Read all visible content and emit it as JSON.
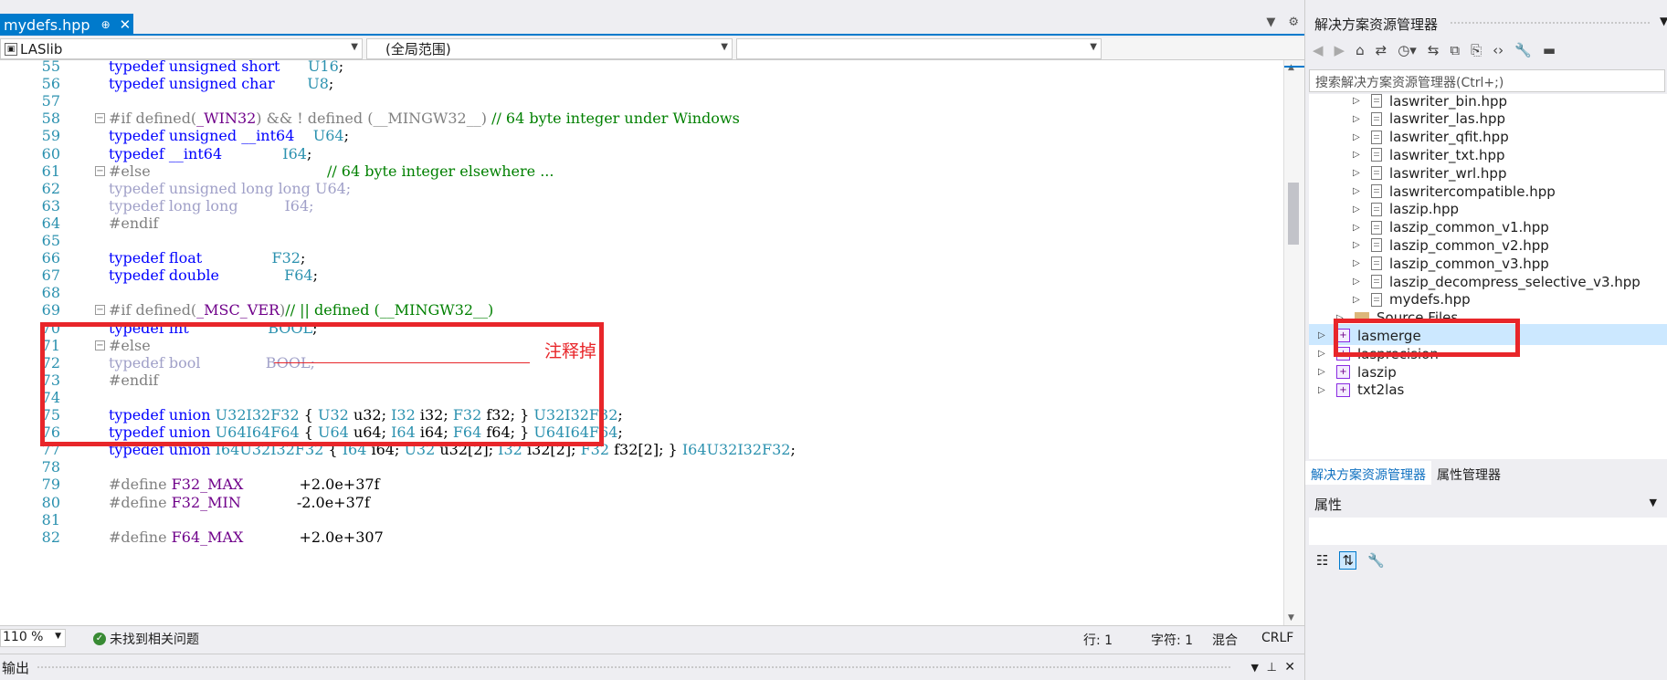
{
  "editor": {
    "tab_title": "mydefs.hpp",
    "tab_pin": "⊕",
    "tab_close": "✕",
    "nav_project": "LASlib",
    "nav_scope": "(全局范围)",
    "nav_member": ""
  },
  "code_lines": [
    {
      "n": "55",
      "tokens": [
        [
          "kw",
          "typedef"
        ],
        [
          "tx",
          " "
        ],
        [
          "kw",
          "unsigned short"
        ],
        [
          "tx",
          "      "
        ],
        [
          "ty",
          "U16"
        ],
        [
          "tx",
          ";"
        ]
      ]
    },
    {
      "n": "56",
      "tokens": [
        [
          "kw",
          "typedef"
        ],
        [
          "tx",
          " "
        ],
        [
          "kw",
          "unsigned char"
        ],
        [
          "tx",
          "       "
        ],
        [
          "ty",
          "U8"
        ],
        [
          "tx",
          ";"
        ]
      ]
    },
    {
      "n": "57",
      "tokens": []
    },
    {
      "n": "58",
      "fold": "−",
      "tokens": [
        [
          "pp",
          "#if defined("
        ],
        [
          "mc",
          "_WIN32"
        ],
        [
          "pp",
          ") && ! defined (__MINGW32__) "
        ],
        [
          "cm",
          "// 64 byte integer under Windows"
        ]
      ]
    },
    {
      "n": "59",
      "tokens": [
        [
          "kw",
          "typedef"
        ],
        [
          "tx",
          " "
        ],
        [
          "kw",
          "unsigned __int64"
        ],
        [
          "tx",
          "    "
        ],
        [
          "ty",
          "U64"
        ],
        [
          "tx",
          ";"
        ]
      ]
    },
    {
      "n": "60",
      "tokens": [
        [
          "kw",
          "typedef"
        ],
        [
          "tx",
          " "
        ],
        [
          "kw",
          "__int64"
        ],
        [
          "tx",
          "             "
        ],
        [
          "ty",
          "I64"
        ],
        [
          "tx",
          ";"
        ]
      ]
    },
    {
      "n": "61",
      "fold": "−",
      "tokens": [
        [
          "pp",
          "#else"
        ],
        [
          "tx",
          "                                      "
        ],
        [
          "cm",
          "// 64 byte integer elsewhere ..."
        ]
      ]
    },
    {
      "n": "62",
      "tokens": [
        [
          "gr",
          "typedef unsigned long long "
        ],
        [
          "gr",
          "U64;"
        ]
      ]
    },
    {
      "n": "63",
      "tokens": [
        [
          "gr",
          "typedef long long"
        ],
        [
          "tx",
          "          "
        ],
        [
          "gr",
          "I64;"
        ]
      ]
    },
    {
      "n": "64",
      "tokens": [
        [
          "pp",
          "#endif"
        ]
      ]
    },
    {
      "n": "65",
      "tokens": []
    },
    {
      "n": "66",
      "tokens": [
        [
          "kw",
          "typedef"
        ],
        [
          "tx",
          " "
        ],
        [
          "kw",
          "float"
        ],
        [
          "tx",
          "               "
        ],
        [
          "ty",
          "F32"
        ],
        [
          "tx",
          ";"
        ]
      ]
    },
    {
      "n": "67",
      "tokens": [
        [
          "kw",
          "typedef"
        ],
        [
          "tx",
          " "
        ],
        [
          "kw",
          "double"
        ],
        [
          "tx",
          "              "
        ],
        [
          "ty",
          "F64"
        ],
        [
          "tx",
          ";"
        ]
      ]
    },
    {
      "n": "68",
      "tokens": []
    },
    {
      "n": "69",
      "fold": "−",
      "tokens": [
        [
          "pp",
          "#if defined("
        ],
        [
          "mc",
          "_MSC_VER"
        ],
        [
          "pp",
          ")"
        ],
        [
          "cm",
          "// || defined (__MINGW32__)"
        ]
      ]
    },
    {
      "n": "70",
      "tokens": [
        [
          "kw",
          "typedef"
        ],
        [
          "tx",
          " "
        ],
        [
          "kw",
          "int"
        ],
        [
          "tx",
          "                 "
        ],
        [
          "ty",
          "BOOL"
        ],
        [
          "tx",
          ";"
        ]
      ]
    },
    {
      "n": "71",
      "fold": "−",
      "tokens": [
        [
          "pp",
          "#else"
        ]
      ]
    },
    {
      "n": "72",
      "tokens": [
        [
          "gr",
          "typedef bool"
        ],
        [
          "tx",
          "              "
        ],
        [
          "gr",
          "BOOL;"
        ]
      ]
    },
    {
      "n": "73",
      "tokens": [
        [
          "pp",
          "#endif"
        ]
      ]
    },
    {
      "n": "74",
      "tokens": []
    },
    {
      "n": "75",
      "tokens": [
        [
          "kw",
          "typedef"
        ],
        [
          "tx",
          " "
        ],
        [
          "kw",
          "union"
        ],
        [
          "tx",
          " "
        ],
        [
          "ty",
          "U32I32F32"
        ],
        [
          "tx",
          " { "
        ],
        [
          "ty",
          "U32"
        ],
        [
          "tx",
          " u32; "
        ],
        [
          "ty",
          "I32"
        ],
        [
          "tx",
          " i32; "
        ],
        [
          "ty",
          "F32"
        ],
        [
          "tx",
          " f32; } "
        ],
        [
          "ty",
          "U32I32F32"
        ],
        [
          "tx",
          ";"
        ]
      ]
    },
    {
      "n": "76",
      "tokens": [
        [
          "kw",
          "typedef"
        ],
        [
          "tx",
          " "
        ],
        [
          "kw",
          "union"
        ],
        [
          "tx",
          " "
        ],
        [
          "ty",
          "U64I64F64"
        ],
        [
          "tx",
          " { "
        ],
        [
          "ty",
          "U64"
        ],
        [
          "tx",
          " u64; "
        ],
        [
          "ty",
          "I64"
        ],
        [
          "tx",
          " i64; "
        ],
        [
          "ty",
          "F64"
        ],
        [
          "tx",
          " f64; } "
        ],
        [
          "ty",
          "U64I64F64"
        ],
        [
          "tx",
          ";"
        ]
      ]
    },
    {
      "n": "77",
      "tokens": [
        [
          "kw",
          "typedef"
        ],
        [
          "tx",
          " "
        ],
        [
          "kw",
          "union"
        ],
        [
          "tx",
          " "
        ],
        [
          "ty",
          "I64U32I32F32"
        ],
        [
          "tx",
          " { "
        ],
        [
          "ty",
          "I64"
        ],
        [
          "tx",
          " i64; "
        ],
        [
          "ty",
          "U32"
        ],
        [
          "tx",
          " u32[2]; "
        ],
        [
          "ty",
          "I32"
        ],
        [
          "tx",
          " i32[2]; "
        ],
        [
          "ty",
          "F32"
        ],
        [
          "tx",
          " f32[2]; } "
        ],
        [
          "ty",
          "I64U32I32F32"
        ],
        [
          "tx",
          ";"
        ]
      ]
    },
    {
      "n": "78",
      "tokens": []
    },
    {
      "n": "79",
      "tokens": [
        [
          "pp",
          "#define "
        ],
        [
          "mc",
          "F32_MAX"
        ],
        [
          "tx",
          "            +2.0e+37f"
        ]
      ]
    },
    {
      "n": "80",
      "tokens": [
        [
          "pp",
          "#define "
        ],
        [
          "mc",
          "F32_MIN"
        ],
        [
          "tx",
          "            -2.0e+37f"
        ]
      ]
    },
    {
      "n": "81",
      "tokens": []
    },
    {
      "n": "82",
      "tokens": [
        [
          "pp",
          "#define "
        ],
        [
          "mc",
          "F64_MAX"
        ],
        [
          "tx",
          "            +2.0e+307"
        ]
      ]
    }
  ],
  "annotation": "注释掉",
  "status": {
    "zoom": "110 %",
    "issues": "未找到相关问题",
    "line": "行: 1",
    "char": "字符: 1",
    "mode": "混合",
    "eol": "CRLF"
  },
  "output_panel": {
    "title": "输出"
  },
  "solution_explorer": {
    "title": "解决方案资源管理器",
    "search_placeholder": "搜索解决方案资源管理器(Ctrl+;)",
    "items": [
      {
        "label": "laswriter_bin.hpp",
        "kind": "file",
        "level": 2
      },
      {
        "label": "laswriter_las.hpp",
        "kind": "file",
        "level": 2
      },
      {
        "label": "laswriter_qfit.hpp",
        "kind": "file",
        "level": 2
      },
      {
        "label": "laswriter_txt.hpp",
        "kind": "file",
        "level": 2
      },
      {
        "label": "laswriter_wrl.hpp",
        "kind": "file",
        "level": 2
      },
      {
        "label": "laswritercompatible.hpp",
        "kind": "file",
        "level": 2
      },
      {
        "label": "laszip.hpp",
        "kind": "file",
        "level": 2
      },
      {
        "label": "laszip_common_v1.hpp",
        "kind": "file",
        "level": 2
      },
      {
        "label": "laszip_common_v2.hpp",
        "kind": "file",
        "level": 2
      },
      {
        "label": "laszip_common_v3.hpp",
        "kind": "file",
        "level": 2
      },
      {
        "label": "laszip_decompress_selective_v3.hpp",
        "kind": "file",
        "level": 2
      },
      {
        "label": "mydefs.hpp",
        "kind": "file",
        "level": 2,
        "selected": true
      },
      {
        "label": "Source Files",
        "kind": "folder",
        "level": 1
      },
      {
        "label": "lasmerge",
        "kind": "project",
        "level": 0
      },
      {
        "label": "lasprecision",
        "kind": "project",
        "level": 0
      },
      {
        "label": "laszip",
        "kind": "project",
        "level": 0
      },
      {
        "label": "txt2las",
        "kind": "project",
        "level": 0
      }
    ],
    "tab_solution": "解决方案资源管理器",
    "tab_props": "属性管理器"
  },
  "properties": {
    "title": "属性"
  },
  "colors": {
    "accent": "#007acc",
    "highlight": "#e8262a",
    "keyword": "#0000ff",
    "type": "#2b91af",
    "comment": "#008000",
    "macro": "#6f008a"
  }
}
